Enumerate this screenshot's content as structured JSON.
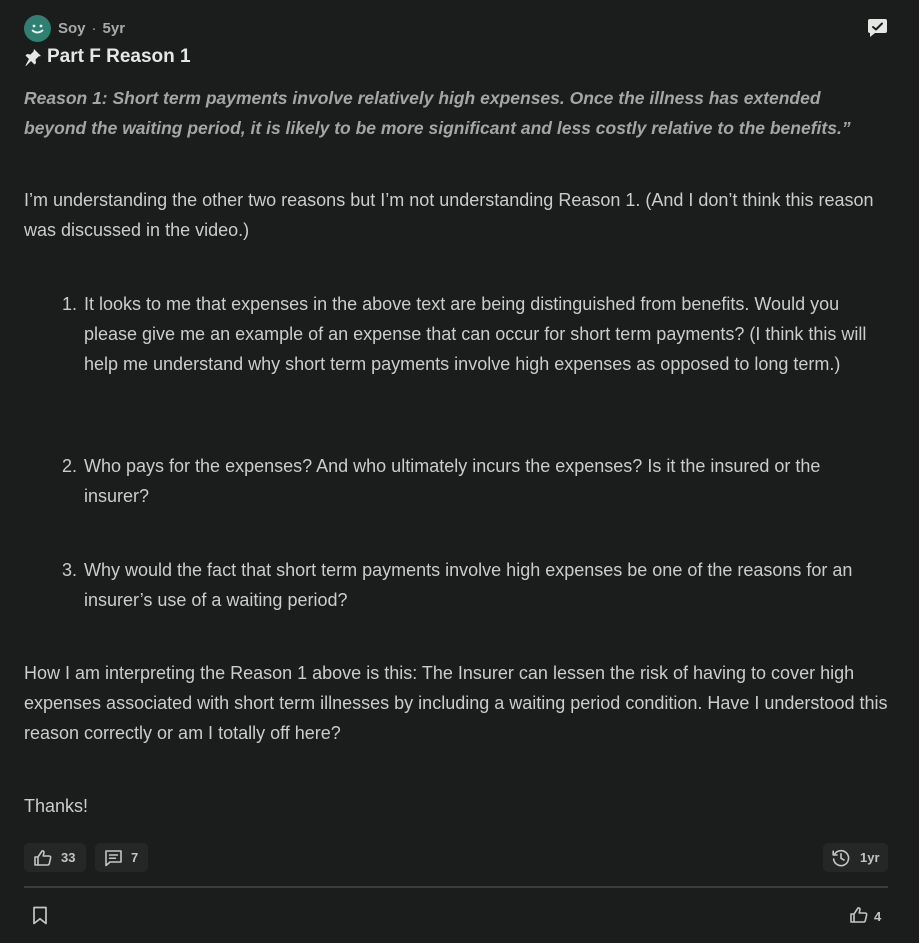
{
  "header": {
    "author": "Soy",
    "separator": "·",
    "age": "5yr"
  },
  "title": "Part F Reason 1",
  "quote": "Reason 1: Short term payments involve relatively high expenses. Once the illness has extended beyond the waiting period, it is likely to be more significant and less costly relative to the benefits.”",
  "body": {
    "intro": "I’m understanding the other two reasons but I’m not understanding Reason 1. (And I don’t think this reason was discussed in the video.)",
    "questions": [
      {
        "num": "1.",
        "text": "It looks to me that expenses in the above text are being distinguished from benefits. Would you please give me an example of an expense that can occur for short term payments? (I think this will help me understand why short term payments involve high expenses as opposed to long term.)"
      },
      {
        "num": "2.",
        "text": "Who pays for the expenses? And who ultimately incurs the expenses? Is it the insured or the insurer?"
      },
      {
        "num": "3.",
        "text": "Why would the fact that short term payments involve high expenses be one of the reasons for an insurer’s use of a waiting period?"
      }
    ],
    "interpretation": "How I am interpreting the Reason 1 above is this: The Insurer can lessen the risk of having to cover high expenses associated with short term illnesses by including a waiting period condition. Have I understood this reason correctly or am I totally off here?",
    "closing": "Thanks!"
  },
  "footer": {
    "likes": "33",
    "comments": "7",
    "last_activity": "1yr"
  },
  "bottom_bar": {
    "likes": "4"
  },
  "icons": {
    "avatar": "smiley-avatar-icon",
    "message": "chat-bubble-icon",
    "pin": "pushpin-icon",
    "like": "thumbs-up-icon",
    "comment": "comment-icon",
    "history": "history-clock-icon",
    "bookmark": "bookmark-icon"
  },
  "colors": {
    "background": "#1b1c1c",
    "avatar": "#2f7f73",
    "text": "#cbcdcb",
    "muted": "#a3a6a4"
  }
}
